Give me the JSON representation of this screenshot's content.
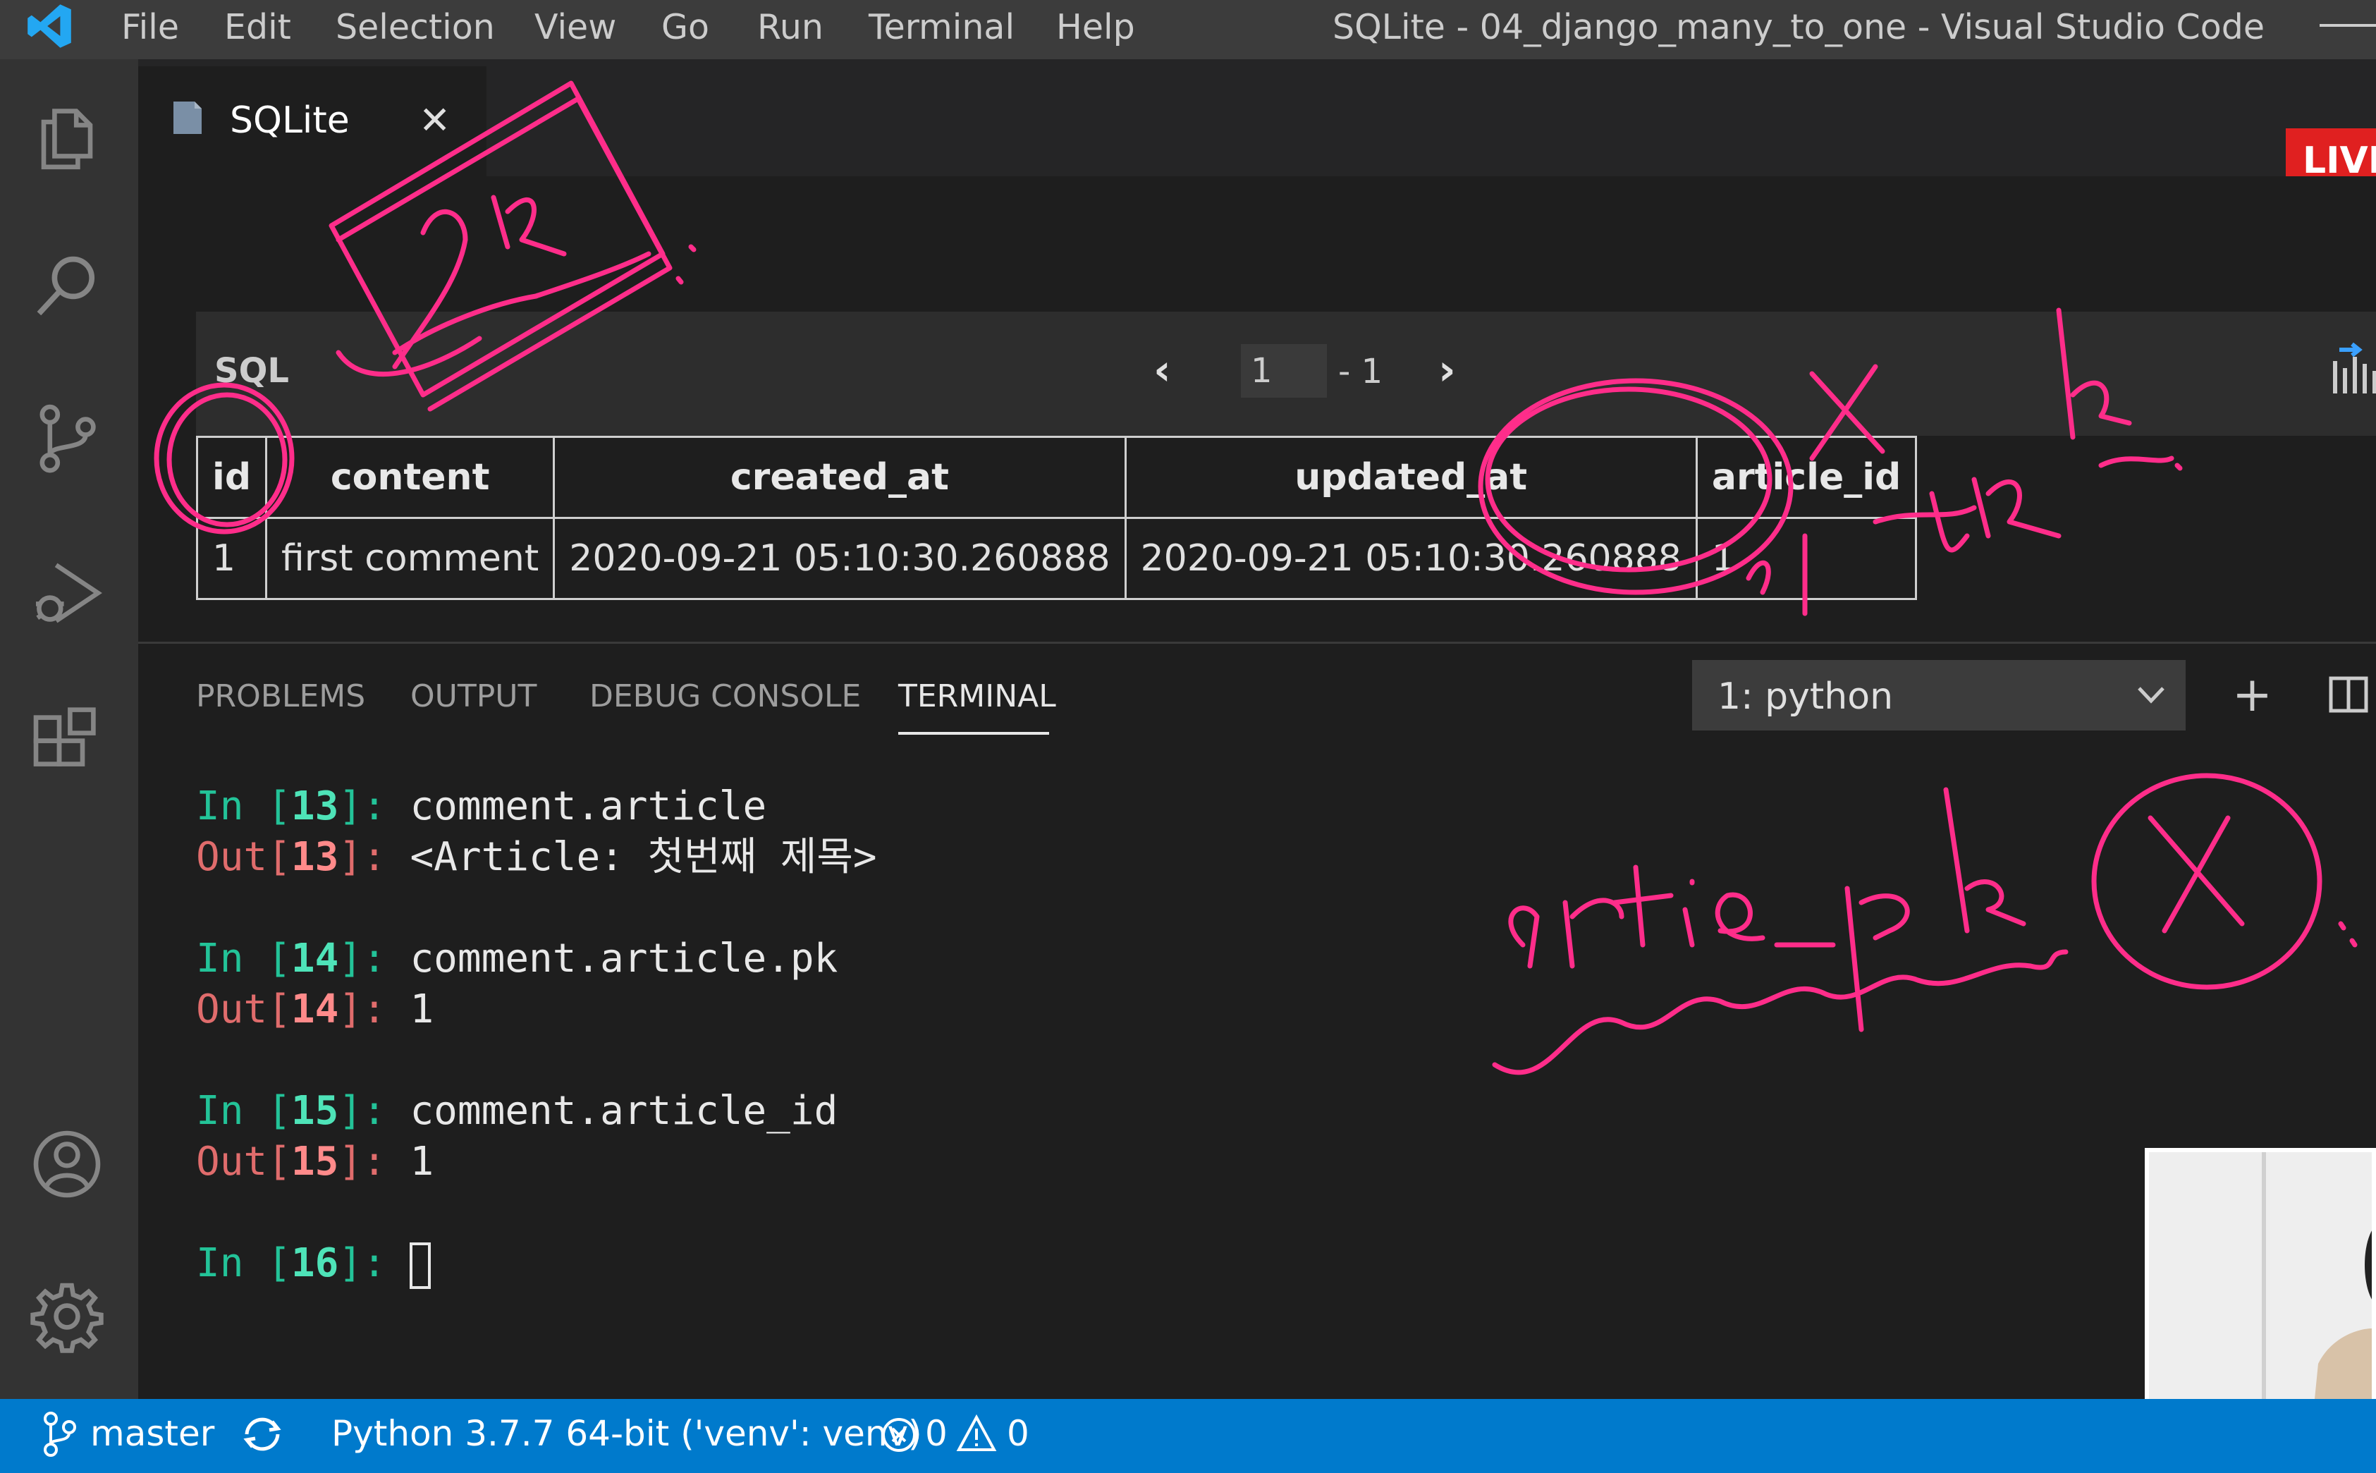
{
  "window": {
    "title": "SQLite - 04_django_many_to_one - Visual Studio Code",
    "menu": [
      "File",
      "Edit",
      "Selection",
      "View",
      "Go",
      "Run",
      "Terminal",
      "Help"
    ]
  },
  "activity_bar": {
    "icons": [
      "files-icon",
      "search-icon",
      "source-control-icon",
      "run-debug-icon",
      "extensions-icon",
      "account-icon",
      "settings-gear-icon"
    ]
  },
  "editor_tab": {
    "label": "SQLite",
    "close_glyph": "✕"
  },
  "live_badge": "LIVE",
  "sqlite_viewer": {
    "sql_label": "SQL",
    "pager": {
      "prev": "‹",
      "current": "1",
      "total": "- 1",
      "next": "›"
    },
    "columns": [
      "id",
      "content",
      "created_at",
      "updated_at",
      "article_id"
    ],
    "rows": [
      [
        "1",
        "first comment",
        "2020-09-21 05:10:30.260888",
        "2020-09-21 05:10:30.260888",
        "1"
      ]
    ]
  },
  "panel": {
    "tabs": [
      "PROBLEMS",
      "OUTPUT",
      "DEBUG CONSOLE",
      "TERMINAL"
    ],
    "active_tab": "TERMINAL",
    "terminal_select": "1: python",
    "new_terminal_glyph": "+"
  },
  "terminal": {
    "lines": [
      {
        "kind": "in",
        "prefix": "In [",
        "num": "13",
        "suffix": "]: ",
        "text": "comment.article"
      },
      {
        "kind": "out",
        "prefix": "Out[",
        "num": "13",
        "suffix": "]: ",
        "text": "<Article: 첫번째 제목>"
      },
      {
        "kind": "in",
        "prefix": "In [",
        "num": "14",
        "suffix": "]: ",
        "text": "comment.article.pk"
      },
      {
        "kind": "out",
        "prefix": "Out[",
        "num": "14",
        "suffix": "]: ",
        "text": "1"
      },
      {
        "kind": "in",
        "prefix": "In [",
        "num": "15",
        "suffix": "]: ",
        "text": "comment.article_id"
      },
      {
        "kind": "out",
        "prefix": "Out[",
        "num": "15",
        "suffix": "]: ",
        "text": "1"
      },
      {
        "kind": "in",
        "prefix": "In [",
        "num": "16",
        "suffix": "]: ",
        "text": ""
      }
    ]
  },
  "status_bar": {
    "branch": "master",
    "interpreter": "Python 3.7.7 64-bit ('venv': venv)",
    "errors": "0",
    "warnings": "0"
  },
  "annotations": {
    "ink_color": "#ff2d8a",
    "handwriting": [
      "pk",
      "X",
      "_pk",
      "artie_pk",
      "X"
    ]
  }
}
